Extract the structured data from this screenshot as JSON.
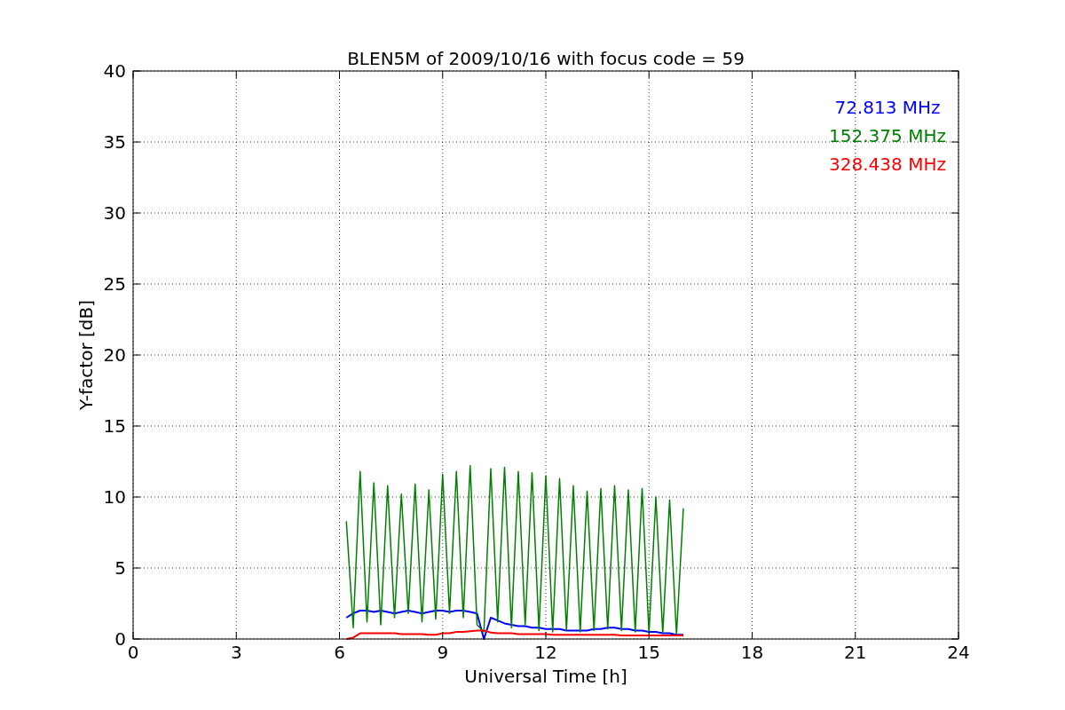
{
  "figure": {
    "chart_data": {
      "type": "line",
      "title": "BLEN5M of 2009/10/16 with focus code = 59",
      "xlabel": "Universal Time [h]",
      "ylabel": "Y-factor [dB]",
      "x": [
        6.2,
        6.4,
        6.6,
        6.8,
        7.0,
        7.2,
        7.4,
        7.6,
        7.8,
        8.0,
        8.2,
        8.4,
        8.6,
        8.8,
        9.0,
        9.2,
        9.4,
        9.6,
        9.8,
        10.0,
        10.2,
        10.4,
        10.6,
        10.8,
        11.0,
        11.2,
        11.4,
        11.6,
        11.8,
        12.0,
        12.2,
        12.4,
        12.6,
        12.8,
        13.0,
        13.2,
        13.4,
        13.6,
        13.8,
        14.0,
        14.2,
        14.4,
        14.6,
        14.8,
        15.0,
        15.2,
        15.4,
        15.6,
        15.8,
        16.0
      ],
      "series": [
        {
          "name": "72.813 MHz",
          "color": "#0000ff",
          "values": [
            1.5,
            1.8,
            2.0,
            2.0,
            1.9,
            2.0,
            1.9,
            1.8,
            1.9,
            2.0,
            1.9,
            1.8,
            1.9,
            2.0,
            2.0,
            1.9,
            2.0,
            2.0,
            1.9,
            1.8,
            0.0,
            1.5,
            1.3,
            1.1,
            1.0,
            0.9,
            0.9,
            0.8,
            0.8,
            0.7,
            0.7,
            0.7,
            0.6,
            0.6,
            0.6,
            0.6,
            0.7,
            0.7,
            0.8,
            0.8,
            0.7,
            0.7,
            0.6,
            0.6,
            0.5,
            0.5,
            0.4,
            0.4,
            0.3,
            0.3
          ]
        },
        {
          "name": "152.375 MHz",
          "color": "#008000",
          "values": [
            8.3,
            0.8,
            11.8,
            1.2,
            11.0,
            1.0,
            10.8,
            1.5,
            10.2,
            1.8,
            10.9,
            1.2,
            10.5,
            1.4,
            11.6,
            1.8,
            11.8,
            1.5,
            12.2,
            1.0,
            0.5,
            12.0,
            1.2,
            12.1,
            0.8,
            11.8,
            1.0,
            11.7,
            0.6,
            11.5,
            0.5,
            11.3,
            0.6,
            10.8,
            0.5,
            10.4,
            0.6,
            10.6,
            0.7,
            10.8,
            0.6,
            10.5,
            0.5,
            10.6,
            0.4,
            10.0,
            0.4,
            9.8,
            0.3,
            9.2
          ]
        },
        {
          "name": "328.438 MHz",
          "color": "#ff0000",
          "values": [
            0.0,
            0.1,
            0.4,
            0.4,
            0.4,
            0.4,
            0.4,
            0.4,
            0.35,
            0.35,
            0.35,
            0.35,
            0.3,
            0.3,
            0.4,
            0.4,
            0.5,
            0.5,
            0.55,
            0.6,
            0.6,
            0.45,
            0.4,
            0.4,
            0.4,
            0.35,
            0.35,
            0.35,
            0.35,
            0.35,
            0.3,
            0.3,
            0.3,
            0.3,
            0.3,
            0.3,
            0.3,
            0.3,
            0.3,
            0.3,
            0.25,
            0.25,
            0.25,
            0.25,
            0.25,
            0.25,
            0.25,
            0.25,
            0.25,
            0.25
          ]
        }
      ],
      "grid": true,
      "xlim": [
        0,
        24
      ],
      "ylim": [
        0,
        40
      ],
      "xticks": [
        0,
        3,
        6,
        9,
        12,
        15,
        18,
        21,
        24
      ],
      "yticks": [
        0,
        5,
        10,
        15,
        20,
        25,
        30,
        35,
        40
      ]
    }
  }
}
